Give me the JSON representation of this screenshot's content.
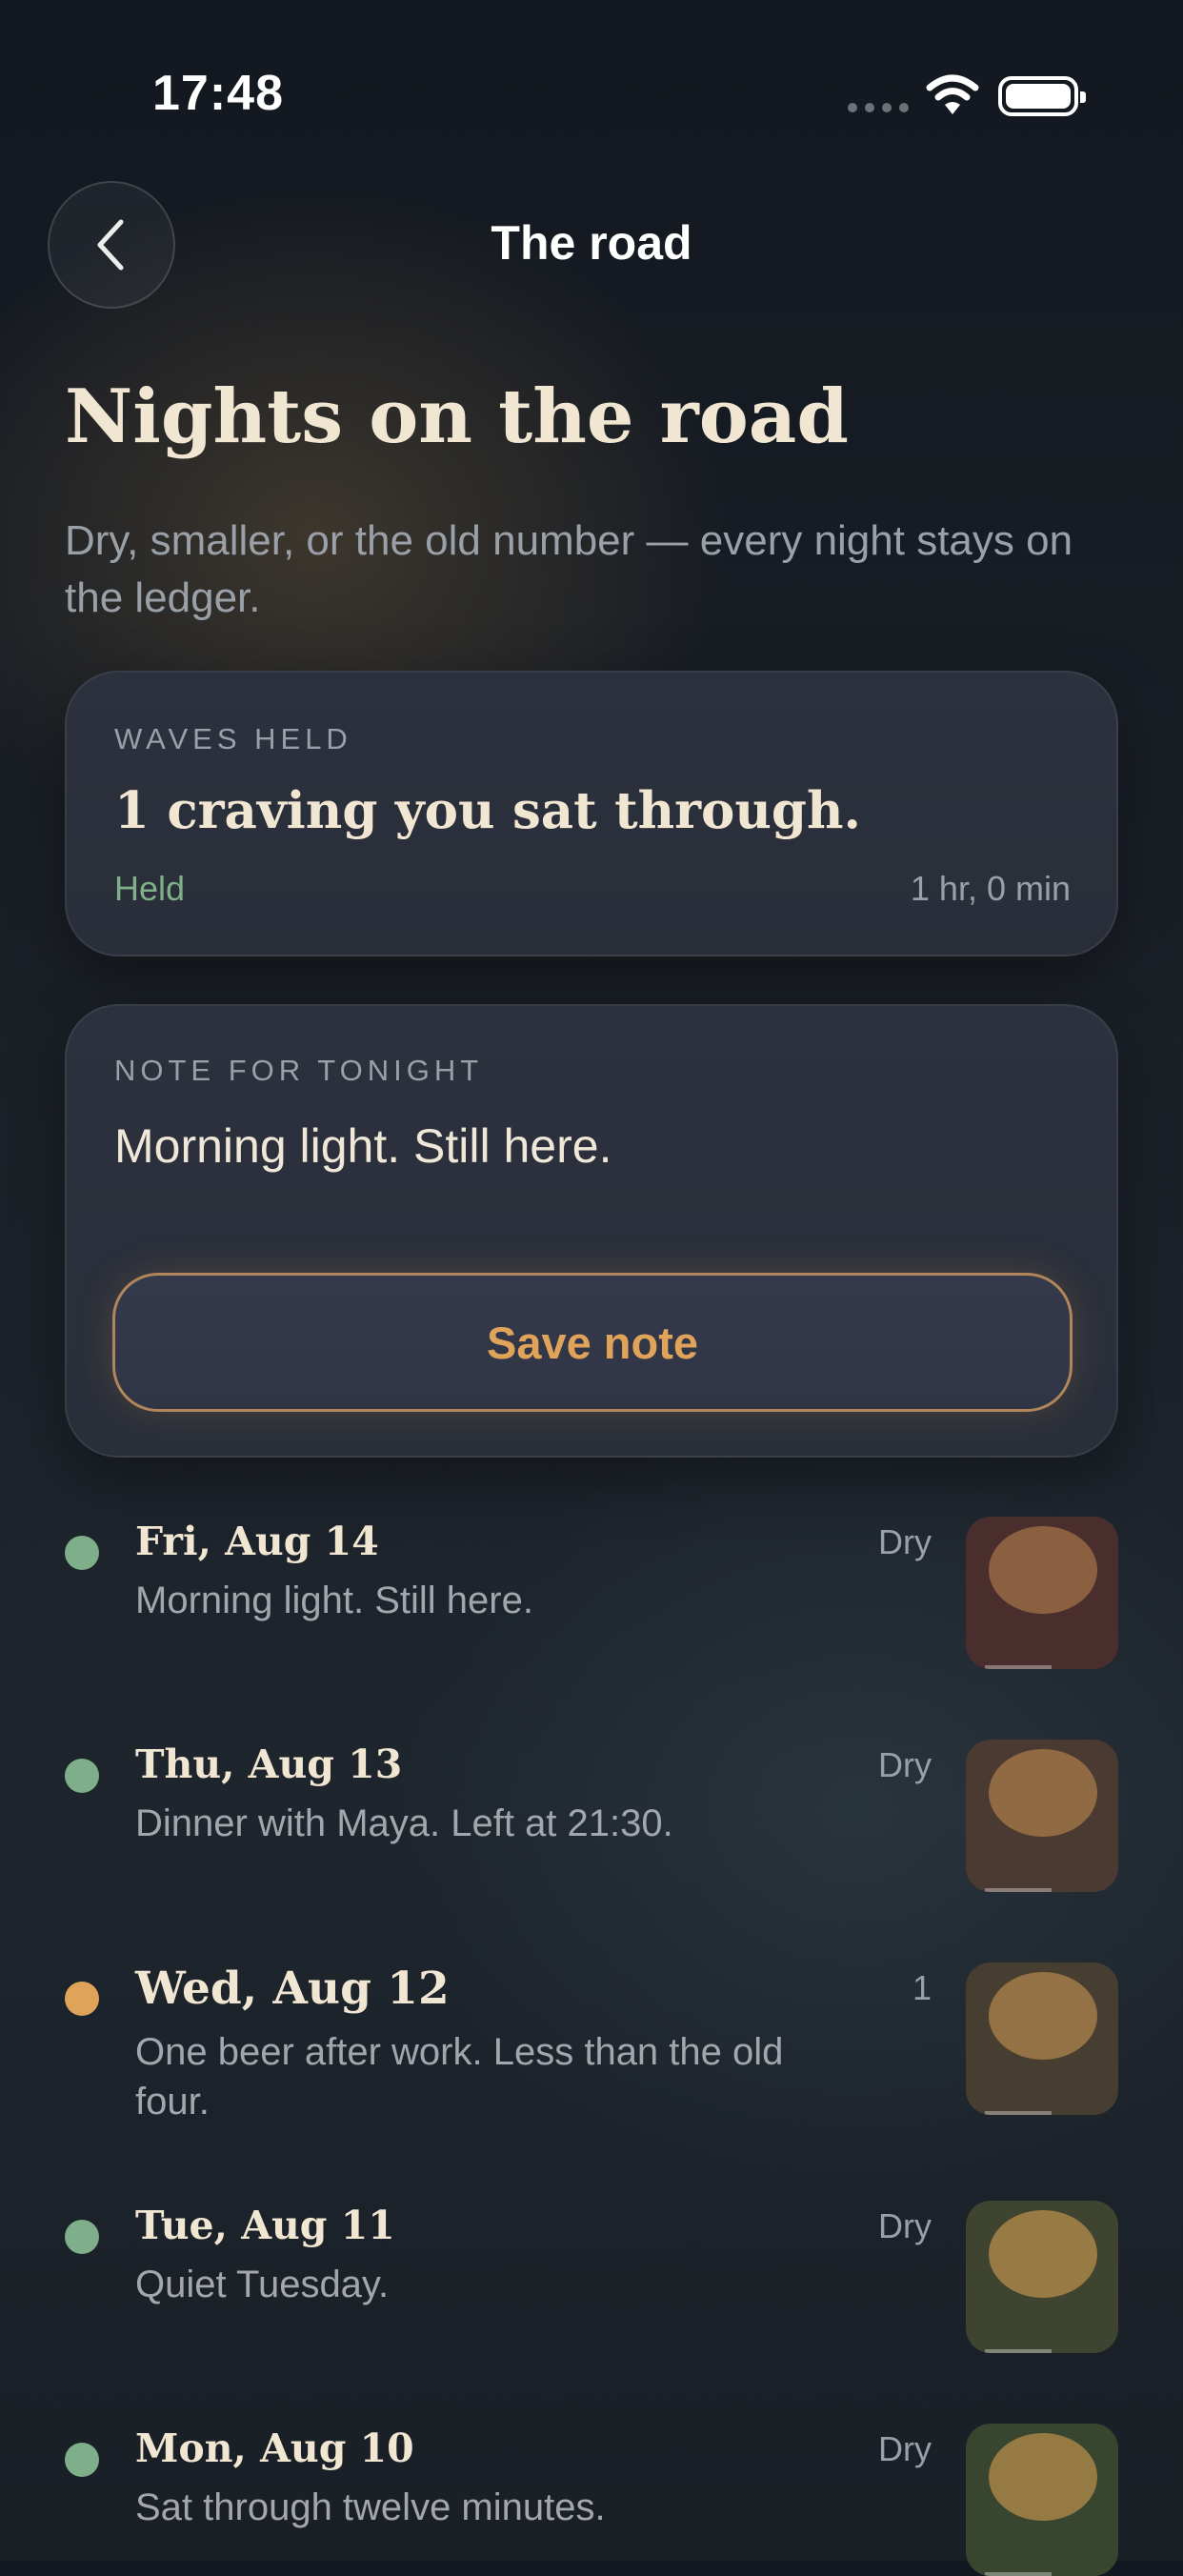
{
  "status_bar": {
    "time": "17:48"
  },
  "nav": {
    "title": "The road"
  },
  "header": {
    "title": "Nights on the road",
    "subtitle": "Dry, smaller, or the old number — every night stays on the ledger."
  },
  "waves_card": {
    "eyebrow": "WAVES HELD",
    "headline": "1 craving you sat through.",
    "status": "Held",
    "duration": "1 hr, 0 min"
  },
  "note_card": {
    "eyebrow": "NOTE FOR TONIGHT",
    "value": "Morning light. Still here.",
    "save_label": "Save note"
  },
  "entries": [
    {
      "date": "Fri, Aug 14",
      "note": "Morning light. Still here.",
      "value": "Dry",
      "dot_color": "#7fae8a",
      "thumb_bg": "#4a2e2e",
      "thumb_blob": "#8a6040"
    },
    {
      "date": "Thu, Aug 13",
      "note": "Dinner with Maya. Left at 21:30.",
      "value": "Dry",
      "dot_color": "#7fae8a",
      "thumb_bg": "#4a3a32",
      "thumb_blob": "#8f6a42"
    },
    {
      "date": "Wed, Aug 12",
      "note": "One beer after work. Less than the old four.",
      "value": "1",
      "dot_color": "#e0a35a",
      "thumb_bg": "#463f31",
      "thumb_blob": "#957245"
    },
    {
      "date": "Tue, Aug 11",
      "note": "Quiet Tuesday.",
      "value": "Dry",
      "dot_color": "#7fae8a",
      "thumb_bg": "#3f4430",
      "thumb_blob": "#987a45"
    },
    {
      "date": "Mon, Aug 10",
      "note": "Sat through twelve minutes.",
      "value": "Dry",
      "dot_color": "#7fae8a",
      "thumb_bg": "#38452f",
      "thumb_blob": "#957a44"
    }
  ]
}
